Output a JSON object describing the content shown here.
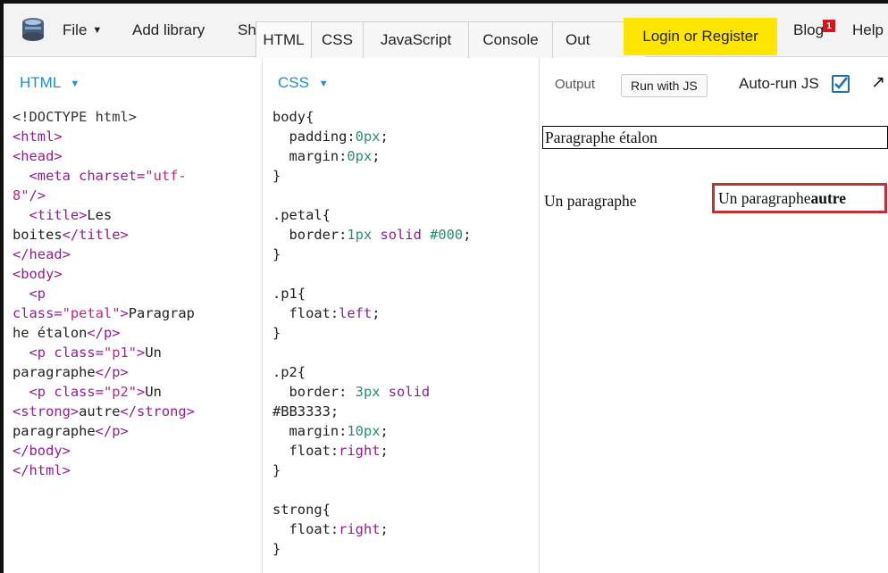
{
  "toolbar": {
    "file": "File",
    "add_library": "Add library",
    "share": "Share",
    "tabs": [
      "HTML",
      "CSS",
      "JavaScript",
      "Console",
      "Output"
    ],
    "tab_visible": [
      "HTML",
      "CSS",
      "JavaScript",
      "Console",
      "Out"
    ],
    "login": "Login or Register",
    "blog": "Blog",
    "blog_badge": "1",
    "help": "Help"
  },
  "html_pane": {
    "title": "HTML"
  },
  "css_pane": {
    "title": "CSS"
  },
  "output_pane": {
    "label": "Output",
    "run_button": "Run with JS",
    "autorun_label": "Auto-run JS",
    "autorun_checked": true,
    "petal_text": "Paragraphe étalon",
    "p1_text": "Un paragraphe",
    "p2_text_before": "Un paragraphe",
    "p2_strong": "autre"
  },
  "colors": {
    "accent": "#1a8fd4",
    "login_bg": "#ffe600",
    "badge_bg": "#d9141c",
    "p2_border": "#BB3333"
  },
  "html_code": [
    [
      [
        "plain",
        "<!DOCTYPE html>"
      ]
    ],
    [
      [
        "tag",
        "<html>"
      ]
    ],
    [
      [
        "tag",
        "<head>"
      ]
    ],
    [
      [
        "tag",
        "  <meta "
      ],
      [
        "attr",
        "charset"
      ],
      [
        "tag",
        "="
      ],
      [
        "str",
        "\"utf-"
      ]
    ],
    [
      [
        "str",
        "8\""
      ],
      [
        "tag",
        "/>"
      ]
    ],
    [
      [
        "tag",
        "  <title>"
      ],
      [
        "txt",
        "Les"
      ]
    ],
    [
      [
        "txt",
        "boites"
      ],
      [
        "tag",
        "</title>"
      ]
    ],
    [
      [
        "tag",
        "</head>"
      ]
    ],
    [
      [
        "tag",
        "<body>"
      ]
    ],
    [
      [
        "tag",
        "  <p"
      ]
    ],
    [
      [
        "attr",
        "class"
      ],
      [
        "tag",
        "="
      ],
      [
        "str",
        "\"petal\""
      ],
      [
        "tag",
        ">"
      ],
      [
        "txt",
        "Paragrap"
      ]
    ],
    [
      [
        "txt",
        "he étalon"
      ],
      [
        "tag",
        "</p>"
      ]
    ],
    [
      [
        "tag",
        "  <p "
      ],
      [
        "attr",
        "class"
      ],
      [
        "tag",
        "="
      ],
      [
        "str",
        "\"p1\""
      ],
      [
        "tag",
        ">"
      ],
      [
        "txt",
        "Un"
      ]
    ],
    [
      [
        "txt",
        "paragraphe"
      ],
      [
        "tag",
        "</p>"
      ]
    ],
    [
      [
        "tag",
        "  <p "
      ],
      [
        "attr",
        "class"
      ],
      [
        "tag",
        "="
      ],
      [
        "str",
        "\"p2\""
      ],
      [
        "tag",
        ">"
      ],
      [
        "txt",
        "Un"
      ]
    ],
    [
      [
        "tag",
        "<strong>"
      ],
      [
        "txt",
        "autre"
      ],
      [
        "tag",
        "</strong>"
      ]
    ],
    [
      [
        "txt",
        "paragraphe"
      ],
      [
        "tag",
        "</p>"
      ]
    ],
    [
      [
        "tag",
        "</body>"
      ]
    ],
    [
      [
        "tag",
        "</html>"
      ]
    ]
  ],
  "css_code": [
    [
      [
        "sel",
        "body{"
      ]
    ],
    [
      [
        "prop",
        "  padding:"
      ],
      [
        "val-num",
        "0px"
      ],
      [
        "prop",
        ";"
      ]
    ],
    [
      [
        "prop",
        "  margin:"
      ],
      [
        "val-num",
        "0px"
      ],
      [
        "prop",
        ";"
      ]
    ],
    [
      [
        "sel",
        "}"
      ]
    ],
    [
      [
        "sel",
        ""
      ]
    ],
    [
      [
        "sel",
        ".petal{"
      ]
    ],
    [
      [
        "prop",
        "  border:"
      ],
      [
        "val-num",
        "1px"
      ],
      [
        "prop",
        " "
      ],
      [
        "val-kw",
        "solid"
      ],
      [
        "prop",
        " "
      ],
      [
        "val-num",
        "#000"
      ],
      [
        "prop",
        ";"
      ]
    ],
    [
      [
        "sel",
        "}"
      ]
    ],
    [
      [
        "sel",
        ""
      ]
    ],
    [
      [
        "sel",
        ".p1{"
      ]
    ],
    [
      [
        "prop",
        "  float:"
      ],
      [
        "val-kw",
        "left"
      ],
      [
        "prop",
        ";"
      ]
    ],
    [
      [
        "sel",
        "}"
      ]
    ],
    [
      [
        "sel",
        ""
      ]
    ],
    [
      [
        "sel",
        ".p2{"
      ]
    ],
    [
      [
        "prop",
        "  border: "
      ],
      [
        "val-num",
        "3px"
      ],
      [
        "prop",
        " "
      ],
      [
        "val-kw",
        "solid"
      ]
    ],
    [
      [
        "val-hex",
        "#BB3333"
      ],
      [
        "prop",
        ";"
      ]
    ],
    [
      [
        "prop",
        "  margin:"
      ],
      [
        "val-num",
        "10px"
      ],
      [
        "prop",
        ";"
      ]
    ],
    [
      [
        "prop",
        "  float:"
      ],
      [
        "val-kw",
        "right"
      ],
      [
        "prop",
        ";"
      ]
    ],
    [
      [
        "sel",
        "}"
      ]
    ],
    [
      [
        "sel",
        ""
      ]
    ],
    [
      [
        "sel",
        "strong{"
      ]
    ],
    [
      [
        "prop",
        "  float:"
      ],
      [
        "val-kw",
        "right"
      ],
      [
        "prop",
        ";"
      ]
    ],
    [
      [
        "sel",
        "}"
      ]
    ]
  ]
}
